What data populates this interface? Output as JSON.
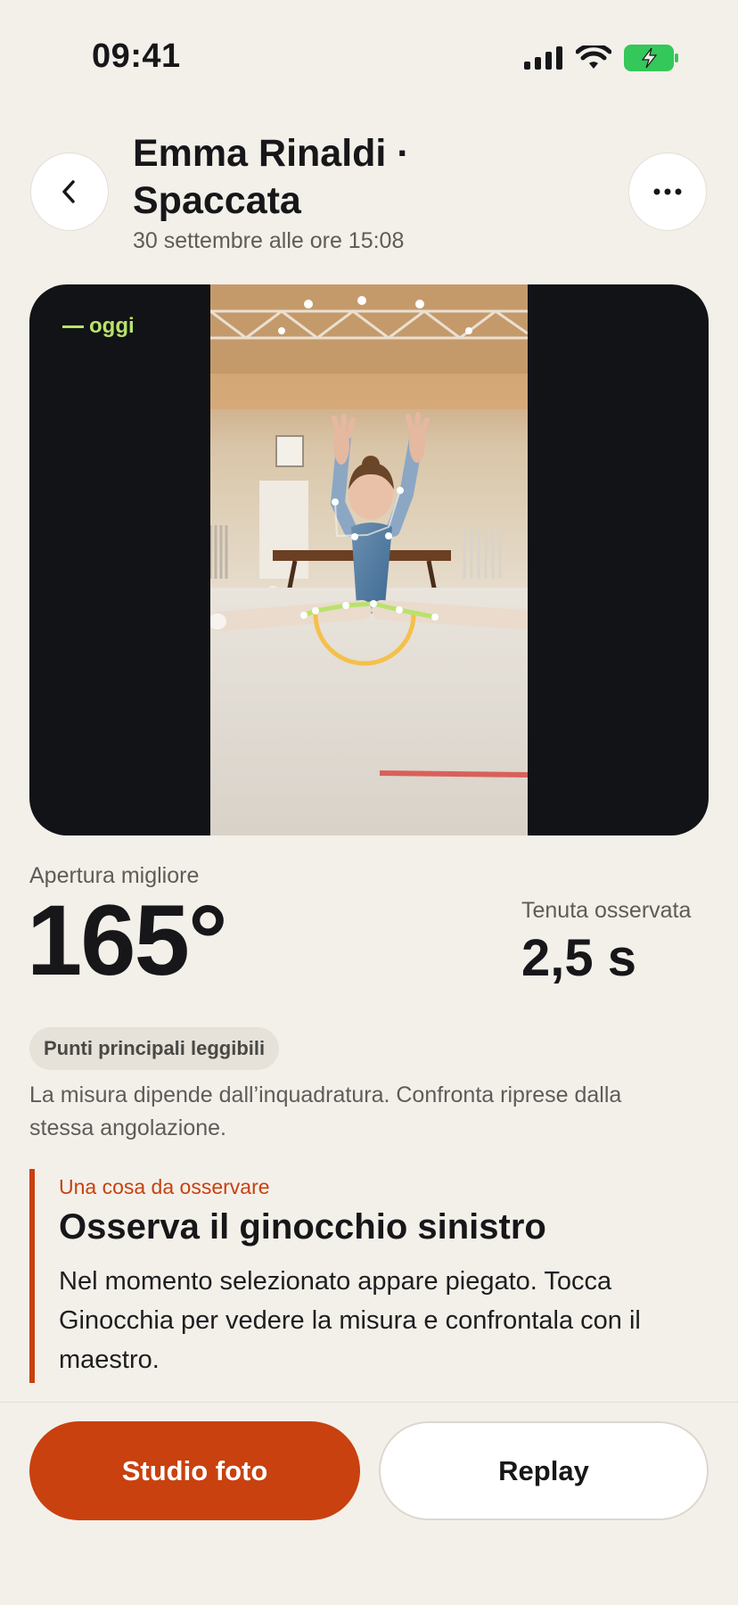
{
  "status_bar": {
    "time": "09:41"
  },
  "header": {
    "title": "Emma Rinaldi · Spaccata",
    "subtitle": "30 settembre alle ore 15:08"
  },
  "video": {
    "label": "oggi",
    "accent_color": "#B8E36A",
    "arc_color": "#F5C04A"
  },
  "metrics": {
    "best_label": "Apertura migliore",
    "best_value": "165°",
    "hold_label": "Tenuta osservata",
    "hold_value": "2,5 s"
  },
  "quality": {
    "chip": "Punti principali leggibili",
    "note": "La misura dipende dall’inquadratura. Confronta riprese dalla stessa angolazione."
  },
  "callout": {
    "kicker": "Una cosa da osservare",
    "title": "Osserva il ginocchio sinistro",
    "text": "Nel momento selezionato appare piegato. Tocca Ginocchia per vedere la misura e confrontala con il maestro."
  },
  "actions": {
    "primary": "Studio foto",
    "secondary": "Replay"
  },
  "colors": {
    "background": "#F3F0EA",
    "accent": "#C8410F",
    "battery": "#34C759"
  }
}
